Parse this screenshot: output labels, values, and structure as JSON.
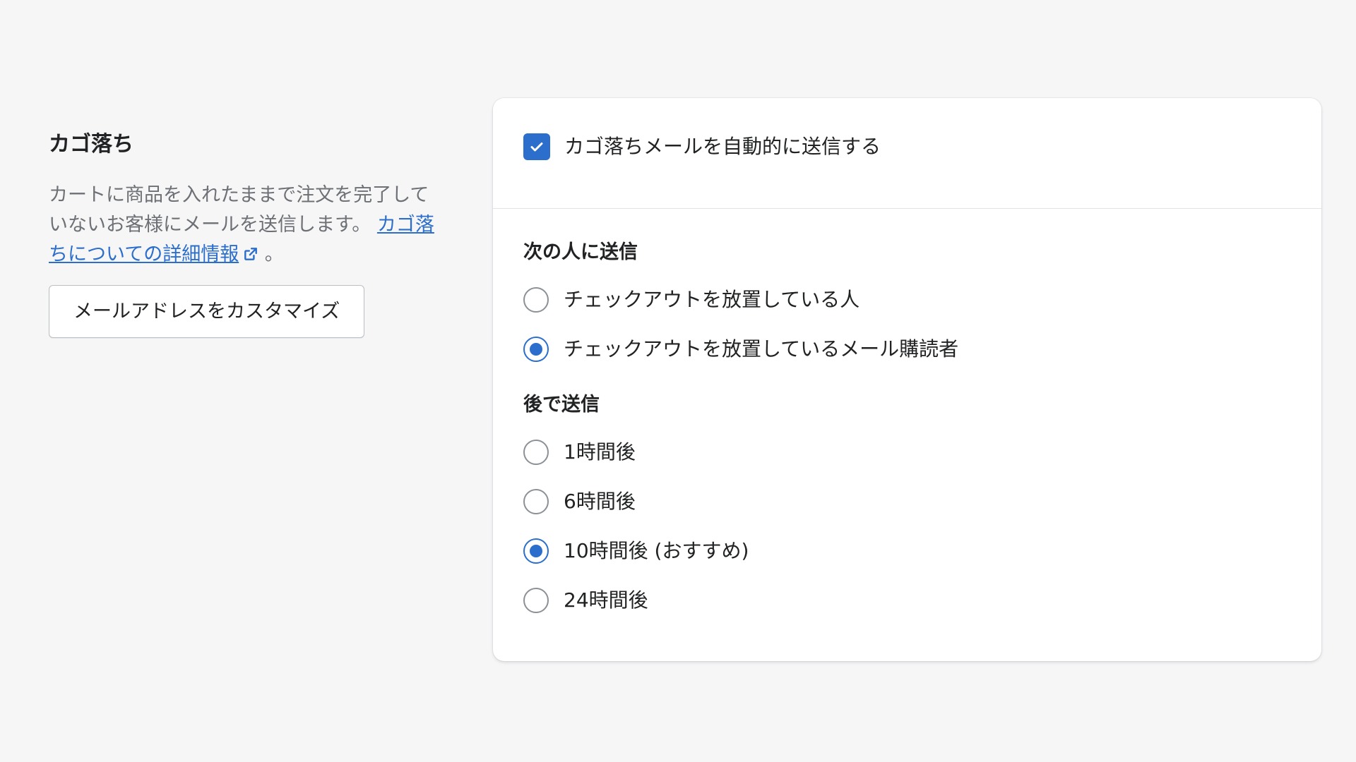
{
  "annotation": {
    "title": "カゴ落ち",
    "description": "カートに商品を入れたままで注文を完了していないお客様にメールを送信します。",
    "link_text": "カゴ落ちについての詳細情報",
    "link_suffix": "。",
    "customize_button": "メールアドレスをカスタマイズ"
  },
  "card": {
    "auto_send": {
      "label": "カゴ落ちメールを自動的に送信する",
      "checked": true
    },
    "recipients": {
      "title": "次の人に送信",
      "options": [
        {
          "label": "チェックアウトを放置している人",
          "selected": false
        },
        {
          "label": "チェックアウトを放置しているメール購読者",
          "selected": true
        }
      ]
    },
    "delay": {
      "title": "後で送信",
      "options": [
        {
          "label": "1時間後",
          "selected": false
        },
        {
          "label": "6時間後",
          "selected": false
        },
        {
          "label": "10時間後 (おすすめ)",
          "selected": true
        },
        {
          "label": "24時間後",
          "selected": false
        }
      ]
    }
  },
  "colors": {
    "accent": "#2c6ecb",
    "background": "#f6f6f7",
    "subdued_text": "#6d7175"
  }
}
